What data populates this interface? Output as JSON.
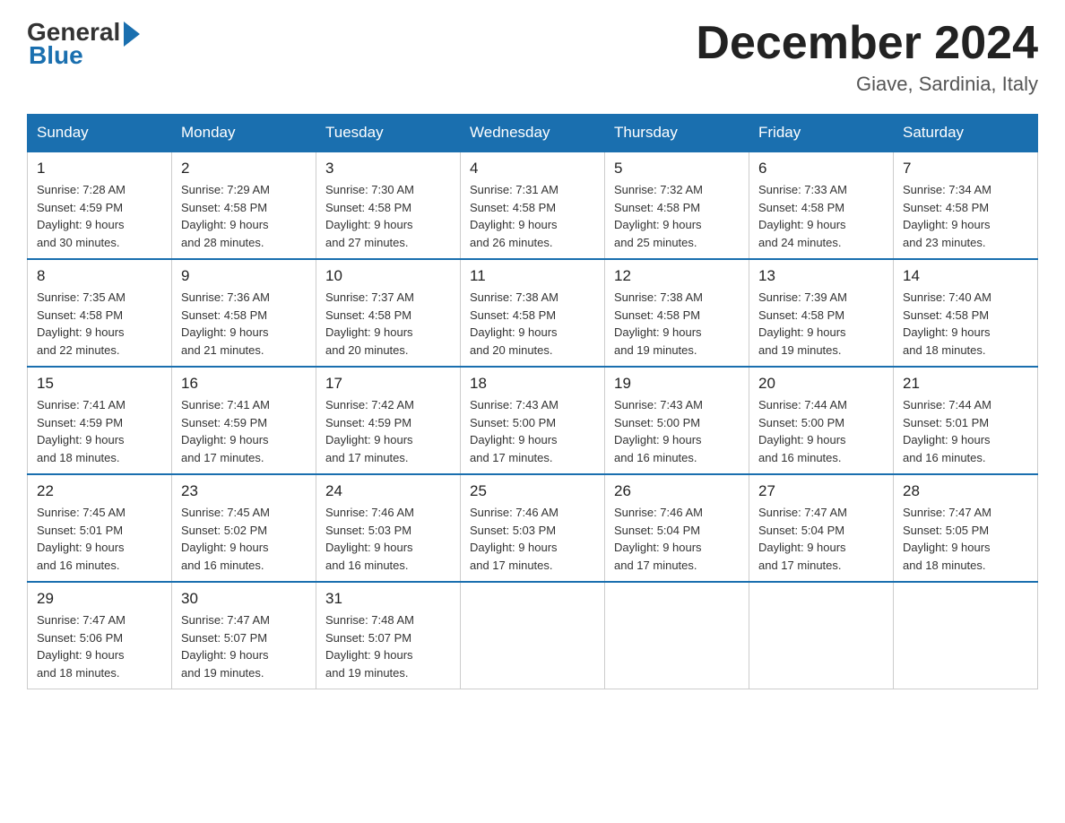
{
  "header": {
    "logo_general": "General",
    "logo_blue": "Blue",
    "month_title": "December 2024",
    "location": "Giave, Sardinia, Italy"
  },
  "calendar": {
    "days_of_week": [
      "Sunday",
      "Monday",
      "Tuesday",
      "Wednesday",
      "Thursday",
      "Friday",
      "Saturday"
    ],
    "weeks": [
      [
        {
          "day": "1",
          "sunrise": "7:28 AM",
          "sunset": "4:59 PM",
          "daylight": "9 hours and 30 minutes."
        },
        {
          "day": "2",
          "sunrise": "7:29 AM",
          "sunset": "4:58 PM",
          "daylight": "9 hours and 28 minutes."
        },
        {
          "day": "3",
          "sunrise": "7:30 AM",
          "sunset": "4:58 PM",
          "daylight": "9 hours and 27 minutes."
        },
        {
          "day": "4",
          "sunrise": "7:31 AM",
          "sunset": "4:58 PM",
          "daylight": "9 hours and 26 minutes."
        },
        {
          "day": "5",
          "sunrise": "7:32 AM",
          "sunset": "4:58 PM",
          "daylight": "9 hours and 25 minutes."
        },
        {
          "day": "6",
          "sunrise": "7:33 AM",
          "sunset": "4:58 PM",
          "daylight": "9 hours and 24 minutes."
        },
        {
          "day": "7",
          "sunrise": "7:34 AM",
          "sunset": "4:58 PM",
          "daylight": "9 hours and 23 minutes."
        }
      ],
      [
        {
          "day": "8",
          "sunrise": "7:35 AM",
          "sunset": "4:58 PM",
          "daylight": "9 hours and 22 minutes."
        },
        {
          "day": "9",
          "sunrise": "7:36 AM",
          "sunset": "4:58 PM",
          "daylight": "9 hours and 21 minutes."
        },
        {
          "day": "10",
          "sunrise": "7:37 AM",
          "sunset": "4:58 PM",
          "daylight": "9 hours and 20 minutes."
        },
        {
          "day": "11",
          "sunrise": "7:38 AM",
          "sunset": "4:58 PM",
          "daylight": "9 hours and 20 minutes."
        },
        {
          "day": "12",
          "sunrise": "7:38 AM",
          "sunset": "4:58 PM",
          "daylight": "9 hours and 19 minutes."
        },
        {
          "day": "13",
          "sunrise": "7:39 AM",
          "sunset": "4:58 PM",
          "daylight": "9 hours and 19 minutes."
        },
        {
          "day": "14",
          "sunrise": "7:40 AM",
          "sunset": "4:58 PM",
          "daylight": "9 hours and 18 minutes."
        }
      ],
      [
        {
          "day": "15",
          "sunrise": "7:41 AM",
          "sunset": "4:59 PM",
          "daylight": "9 hours and 18 minutes."
        },
        {
          "day": "16",
          "sunrise": "7:41 AM",
          "sunset": "4:59 PM",
          "daylight": "9 hours and 17 minutes."
        },
        {
          "day": "17",
          "sunrise": "7:42 AM",
          "sunset": "4:59 PM",
          "daylight": "9 hours and 17 minutes."
        },
        {
          "day": "18",
          "sunrise": "7:43 AM",
          "sunset": "5:00 PM",
          "daylight": "9 hours and 17 minutes."
        },
        {
          "day": "19",
          "sunrise": "7:43 AM",
          "sunset": "5:00 PM",
          "daylight": "9 hours and 16 minutes."
        },
        {
          "day": "20",
          "sunrise": "7:44 AM",
          "sunset": "5:00 PM",
          "daylight": "9 hours and 16 minutes."
        },
        {
          "day": "21",
          "sunrise": "7:44 AM",
          "sunset": "5:01 PM",
          "daylight": "9 hours and 16 minutes."
        }
      ],
      [
        {
          "day": "22",
          "sunrise": "7:45 AM",
          "sunset": "5:01 PM",
          "daylight": "9 hours and 16 minutes."
        },
        {
          "day": "23",
          "sunrise": "7:45 AM",
          "sunset": "5:02 PM",
          "daylight": "9 hours and 16 minutes."
        },
        {
          "day": "24",
          "sunrise": "7:46 AM",
          "sunset": "5:03 PM",
          "daylight": "9 hours and 16 minutes."
        },
        {
          "day": "25",
          "sunrise": "7:46 AM",
          "sunset": "5:03 PM",
          "daylight": "9 hours and 17 minutes."
        },
        {
          "day": "26",
          "sunrise": "7:46 AM",
          "sunset": "5:04 PM",
          "daylight": "9 hours and 17 minutes."
        },
        {
          "day": "27",
          "sunrise": "7:47 AM",
          "sunset": "5:04 PM",
          "daylight": "9 hours and 17 minutes."
        },
        {
          "day": "28",
          "sunrise": "7:47 AM",
          "sunset": "5:05 PM",
          "daylight": "9 hours and 18 minutes."
        }
      ],
      [
        {
          "day": "29",
          "sunrise": "7:47 AM",
          "sunset": "5:06 PM",
          "daylight": "9 hours and 18 minutes."
        },
        {
          "day": "30",
          "sunrise": "7:47 AM",
          "sunset": "5:07 PM",
          "daylight": "9 hours and 19 minutes."
        },
        {
          "day": "31",
          "sunrise": "7:48 AM",
          "sunset": "5:07 PM",
          "daylight": "9 hours and 19 minutes."
        },
        null,
        null,
        null,
        null
      ]
    ],
    "labels": {
      "sunrise": "Sunrise:",
      "sunset": "Sunset:",
      "daylight": "Daylight:"
    }
  }
}
